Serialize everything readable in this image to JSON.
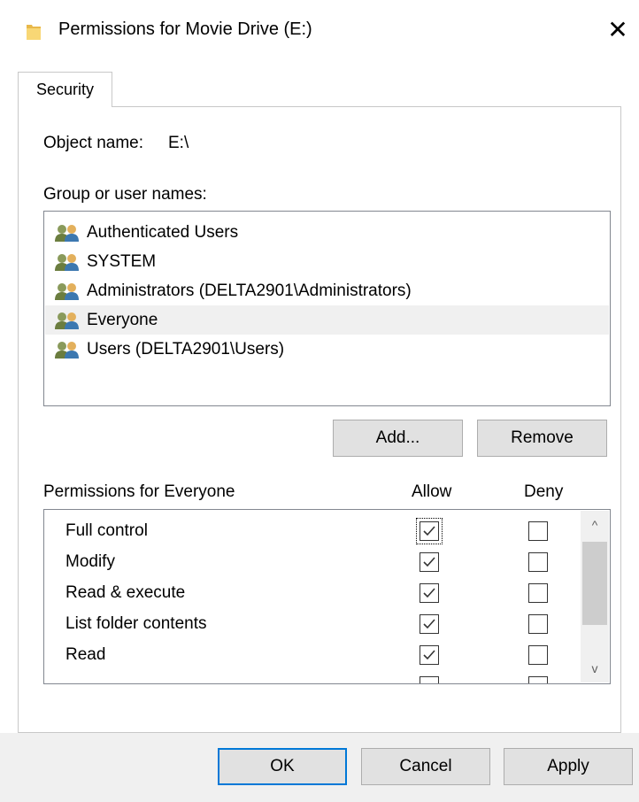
{
  "window": {
    "title": "Permissions for Movie Drive (E:)",
    "close_glyph": "✕"
  },
  "tabs": [
    {
      "label": "Security",
      "selected": true
    }
  ],
  "object": {
    "label": "Object name:",
    "value": "E:\\"
  },
  "groups": {
    "label": "Group or user names:",
    "items": [
      {
        "label": "Authenticated Users",
        "icon": "users-group-icon"
      },
      {
        "label": "SYSTEM",
        "icon": "users-group-icon"
      },
      {
        "label": "Administrators (DELTA2901\\Administrators)",
        "icon": "users-group-icon"
      },
      {
        "label": "Everyone",
        "icon": "users-group-icon",
        "selected": true
      },
      {
        "label": "Users (DELTA2901\\Users)",
        "icon": "users-group-icon"
      }
    ]
  },
  "buttons": {
    "add": "Add...",
    "remove": "Remove",
    "ok": "OK",
    "cancel": "Cancel",
    "apply": "Apply"
  },
  "permissions": {
    "label": "Permissions for Everyone",
    "allow_header": "Allow",
    "deny_header": "Deny",
    "rows": [
      {
        "name": "Full control",
        "allow": true,
        "deny": false
      },
      {
        "name": "Modify",
        "allow": true,
        "deny": false
      },
      {
        "name": "Read & execute",
        "allow": true,
        "deny": false
      },
      {
        "name": "List folder contents",
        "allow": true,
        "deny": false
      },
      {
        "name": "Read",
        "allow": true,
        "deny": false
      }
    ]
  },
  "scrollbar": {
    "up_glyph": "^",
    "down_glyph": "v"
  },
  "colors": {
    "accent": "#0078d7",
    "selection": "#f0f0f0",
    "folder": "#f8d775"
  }
}
